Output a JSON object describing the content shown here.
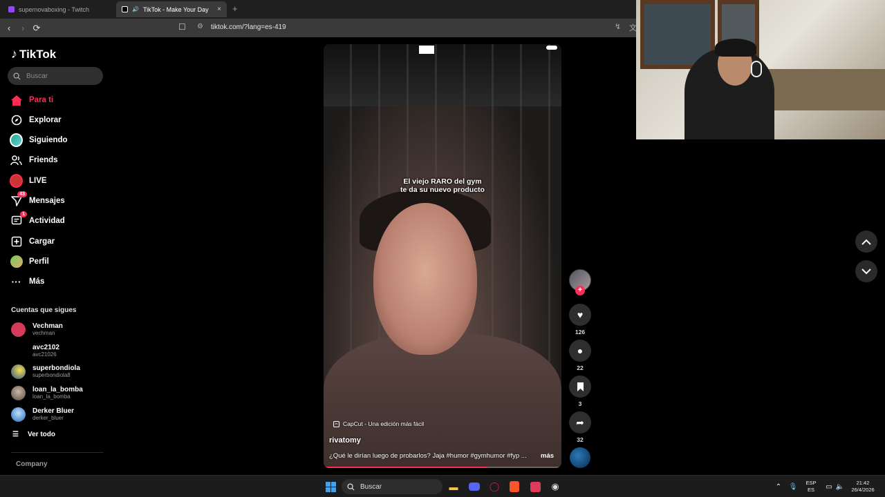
{
  "browser": {
    "tabs": [
      {
        "title": "supernovaboxing - Twitch",
        "close": ""
      },
      {
        "title": "TikTok - Make Your Day",
        "close": "×"
      }
    ],
    "new_tab": "+",
    "back": "‹",
    "forward": "›",
    "reload": "⟳",
    "url": "tiktok.com/?lang=es-419"
  },
  "sidebar": {
    "logo_text": "TikTok",
    "search_placeholder": "Buscar",
    "nav": [
      {
        "label": "Para ti",
        "icon": "home-icon"
      },
      {
        "label": "Explorar",
        "icon": "compass-icon"
      },
      {
        "label": "Siguiendo",
        "icon": "following-avatar-icon"
      },
      {
        "label": "Friends",
        "icon": "friends-icon"
      },
      {
        "label": "LIVE",
        "icon": "live-icon"
      },
      {
        "label": "Mensajes",
        "icon": "messages-icon",
        "badge": "43"
      },
      {
        "label": "Actividad",
        "icon": "activity-icon",
        "badge": "1"
      },
      {
        "label": "Cargar",
        "icon": "upload-icon"
      },
      {
        "label": "Perfil",
        "icon": "profile-avatar-icon"
      },
      {
        "label": "Más",
        "icon": "more-icon"
      }
    ],
    "following_title": "Cuentas que sigues",
    "following": [
      {
        "name": "Vechman",
        "username": "vechman",
        "color": "#d43a5a"
      },
      {
        "name": "avc2102",
        "username": "avc21026",
        "color": "#000000"
      },
      {
        "name": "superbondiola",
        "username": "superbondiola8",
        "color": "#e8d44a"
      },
      {
        "name": "loan_la_bomba",
        "username": "loan_la_bomba",
        "color": "#8a7a70"
      },
      {
        "name": "Derker Bluer",
        "username": "derker_bluer",
        "color": "#4a8ad4"
      }
    ],
    "see_all": "Ver todo",
    "company": "Company"
  },
  "video": {
    "overlay_line1": "El viejo RARO del gym",
    "overlay_line2": "te da su nuevo producto",
    "capcut_label": "CapCut - Una edición más fácil",
    "author": "rivatomy",
    "caption": "¿Qué le dirían luego de probarlos? Jaja #humor #gymhumor #fyp ...",
    "more": "más",
    "progress": 0.69
  },
  "actions": {
    "follow": "+",
    "likes": "126",
    "comments": "22",
    "saves": "3",
    "shares": "32"
  },
  "taskbar": {
    "search": "Buscar",
    "lang_top": "ESP",
    "lang_bottom": "ES",
    "time": "21:42",
    "date": "26/4/2026"
  },
  "colors": {
    "accent": "#fe2c55",
    "background": "#000000"
  }
}
